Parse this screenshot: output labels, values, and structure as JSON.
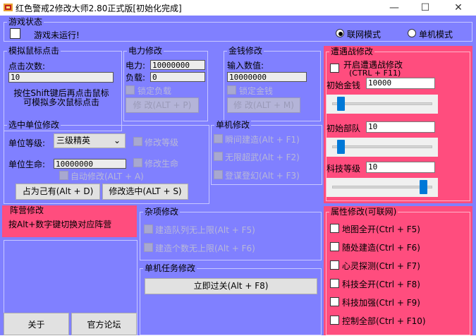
{
  "window": {
    "title": "红色警戒2修改大师2.80正式版[初始化完成]",
    "minimize_glyph": "—",
    "maximize_glyph": "☐",
    "close_glyph": "✕"
  },
  "game_status": {
    "title": "游戏状态",
    "status_text": "游戏未运行!",
    "online_mode_label": "联网模式",
    "single_mode_label": "单机模式"
  },
  "mouse_click": {
    "title": "模拟鼠标点击",
    "count_label": "点击次数:",
    "count_value": "10",
    "hint": "按住Shift键后再点击鼠标可模拟多次鼠标点击"
  },
  "power": {
    "title": "电力修改",
    "power_label": "电力:",
    "power_value": "10000000",
    "load_label": "负载:",
    "load_value": "0",
    "lock_label": "锁定负载",
    "modify_button": "修 改(ALT + P)"
  },
  "money": {
    "title": "金钱修改",
    "input_label": "输入数值:",
    "input_value": "10000000",
    "lock_label": "锁定金钱",
    "modify_button": "修 改(ALT + M)"
  },
  "encounter": {
    "title": "遭遇战修改",
    "enable_label": "开启遭遇战修改",
    "enable_hotkey": "(CTRL + F11)",
    "money_label": "初始金钱",
    "money_value": "10000",
    "troops_label": "初始部队",
    "troops_value": "10",
    "tech_label": "科技等级",
    "tech_value": "10",
    "money_slider_level": 0.05,
    "troops_slider_level": 0.05,
    "tech_slider_level": 0.95
  },
  "unit": {
    "title": "选中单位修改",
    "level_label": "单位等级:",
    "level_selected": "三级精英",
    "modify_level_label": "修改等级",
    "hp_label": "单位生命:",
    "hp_value": "10000000",
    "modify_hp_label": "修改生命",
    "auto_modify_label": "自动修改(ALT + A)",
    "occupy_button": "占为己有(Alt + D)",
    "modify_selected_button": "修改选中(ALT + S)"
  },
  "single": {
    "title": "单机修改",
    "instant_build": "瞬间建造(Alt + F1)",
    "unlimited_super": "无限超武(Alt + F2)",
    "time_travel": "登谋登幻(Alt + F3)"
  },
  "faction": {
    "title": "阵营修改",
    "hint": "按Alt+数字键切换对应阵营"
  },
  "misc": {
    "title": "杂项修改",
    "queue_unlimited": "建造队列无上限(Alt + F5)",
    "count_unlimited": "建造个数无上限(Alt + F6)"
  },
  "mission": {
    "title": "单机任务修改",
    "pass_button": "立即过关(Alt + F8)"
  },
  "attributes": {
    "title": "属性修改(可联网)",
    "items": [
      "地图全开(Ctrl + F5)",
      "随处建造(Ctrl + F6)",
      "心灵探测(Ctrl + F7)",
      "科技全开(Ctrl + F8)",
      "科技加强(Ctrl + F9)",
      "控制全部(Ctrl + F10)"
    ]
  },
  "footer": {
    "about_button": "关于",
    "forum_button": "官方论坛"
  }
}
